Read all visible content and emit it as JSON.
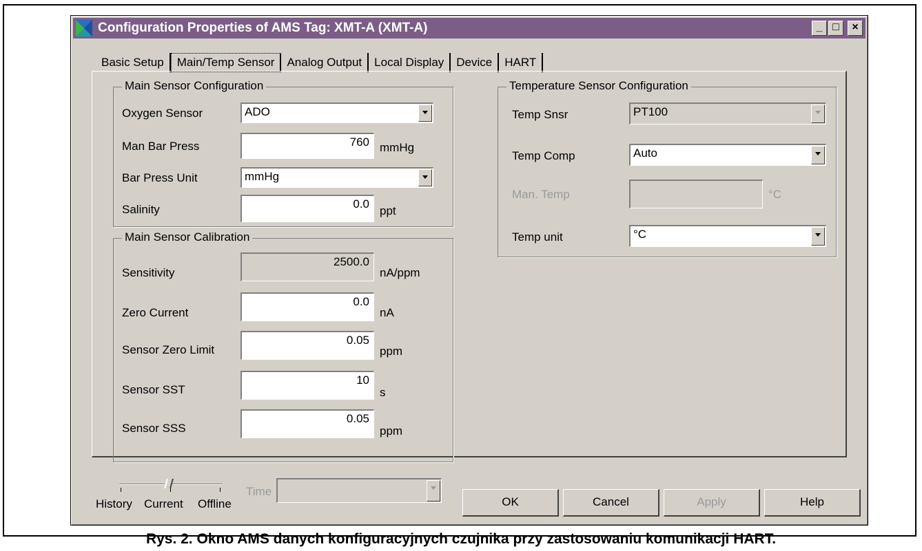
{
  "window": {
    "title": "Configuration Properties of AMS Tag:  XMT-A (XMT-A)",
    "minimize_glyph": "_",
    "maximize_glyph": "□",
    "close_glyph": "×"
  },
  "tabs": [
    {
      "label": "Basic Setup"
    },
    {
      "label": "Main/Temp Sensor"
    },
    {
      "label": "Analog Output"
    },
    {
      "label": "Local Display"
    },
    {
      "label": "Device"
    },
    {
      "label": "HART"
    }
  ],
  "main_config": {
    "title": "Main Sensor Configuration",
    "oxygen_sensor": {
      "label": "Oxygen Sensor",
      "value": "ADO"
    },
    "man_bar_press": {
      "label": "Man Bar Press",
      "value": "760",
      "unit": "mmHg"
    },
    "bar_press_unit": {
      "label": "Bar Press Unit",
      "value": "mmHg"
    },
    "salinity": {
      "label": "Salinity",
      "value": "0.0",
      "unit": "ppt"
    }
  },
  "main_calibration": {
    "title": "Main Sensor Calibration",
    "sensitivity": {
      "label": "Sensitivity",
      "value": "2500.0",
      "unit": "nA/ppm"
    },
    "zero_current": {
      "label": "Zero Current",
      "value": "0.0",
      "unit": "nA"
    },
    "sensor_zero_limit": {
      "label": "Sensor Zero Limit",
      "value": "0.05",
      "unit": "ppm"
    },
    "sensor_sst": {
      "label": "Sensor SST",
      "value": "10",
      "unit": "s"
    },
    "sensor_sss": {
      "label": "Sensor SSS",
      "value": "0.05",
      "unit": "ppm"
    }
  },
  "temp_config": {
    "title": "Temperature Sensor Configuration",
    "temp_snsr": {
      "label": "Temp Snsr",
      "value": "PT100"
    },
    "temp_comp": {
      "label": "Temp Comp",
      "value": "Auto"
    },
    "man_temp": {
      "label": "Man. Temp",
      "value": "",
      "unit": "°C"
    },
    "temp_unit": {
      "label": "Temp unit",
      "value": "°C"
    }
  },
  "footer": {
    "slider_labels": [
      "History",
      "Current",
      "Offline"
    ],
    "time_label": "Time",
    "time_value": "",
    "buttons": {
      "ok": "OK",
      "cancel": "Cancel",
      "apply": "Apply",
      "help": "Help"
    }
  },
  "caption": "Rys. 2. Okno AMS danych konfiguracyjnych czujnika przy zastosowaniu komunikacji HART.",
  "colors": {
    "titlebar": "#7b5d88",
    "dialog": "#d4d0c8"
  }
}
